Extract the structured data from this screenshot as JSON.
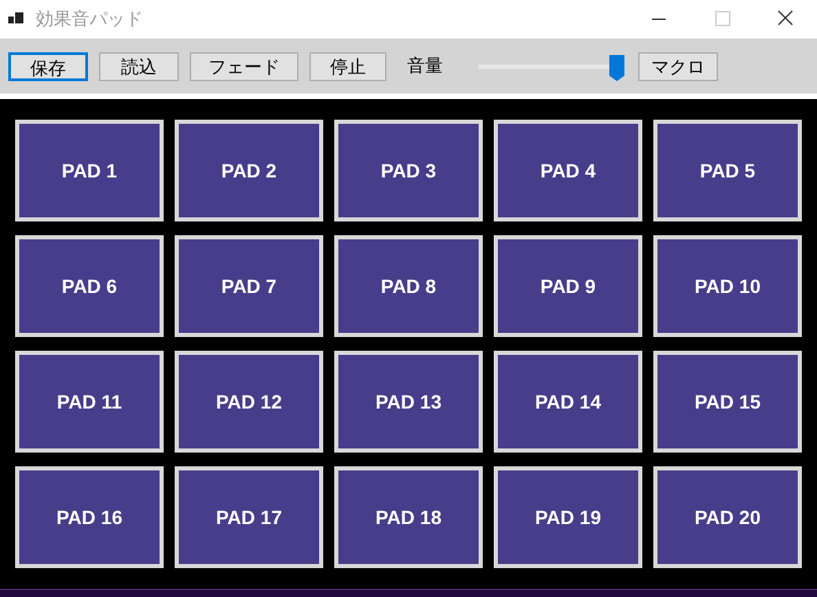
{
  "window": {
    "title": "効果音パッド"
  },
  "toolbar": {
    "buttons": [
      {
        "label": "保存",
        "focused": true
      },
      {
        "label": "読込",
        "focused": false
      },
      {
        "label": "フェード",
        "focused": false
      },
      {
        "label": "停止",
        "focused": false
      }
    ],
    "volume": {
      "label": "音量",
      "level": 0.95
    },
    "macro_button": {
      "label": "マクロ"
    }
  },
  "pads": [
    "PAD 1",
    "PAD 2",
    "PAD 3",
    "PAD 4",
    "PAD 5",
    "PAD 6",
    "PAD 7",
    "PAD 8",
    "PAD 9",
    "PAD 10",
    "PAD 11",
    "PAD 12",
    "PAD 13",
    "PAD 14",
    "PAD 15",
    "PAD 16",
    "PAD 17",
    "PAD 18",
    "PAD 19",
    "PAD 20"
  ]
}
